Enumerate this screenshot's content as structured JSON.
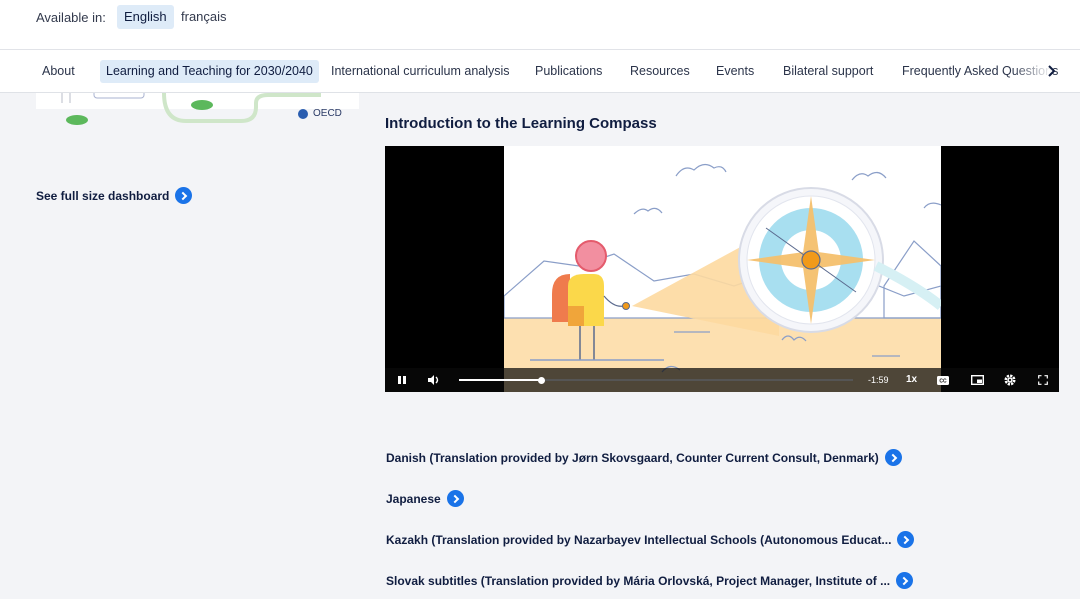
{
  "language_bar": {
    "label": "Available in:",
    "languages": [
      {
        "label": "English",
        "active": true
      },
      {
        "label": "français",
        "active": false
      }
    ]
  },
  "nav": {
    "items": [
      {
        "label": "About"
      },
      {
        "label": "Learning and Teaching for 2030/2040",
        "active": true
      },
      {
        "label": "International curriculum analysis"
      },
      {
        "label": "Publications"
      },
      {
        "label": "Resources"
      },
      {
        "label": "Events"
      },
      {
        "label": "Bilateral support"
      },
      {
        "label": "Frequently Asked Questions"
      }
    ],
    "scroll_icon": "chevron-right-icon"
  },
  "dashboard": {
    "logo_text": "OECD",
    "see_full_label": "See full size dashboard"
  },
  "video": {
    "title": "Introduction to the Learning Compass",
    "remaining_time": "-1:59",
    "speed": "1x",
    "progress_fraction": 0.21,
    "state": "playing"
  },
  "translations": [
    {
      "label": "Danish (Translation provided by Jørn Skovsgaard, Counter Current Consult, Denmark)"
    },
    {
      "label": "Japanese"
    },
    {
      "label": "Kazakh (Translation provided by Nazarbayev Intellectual Schools (Autonomous Educat..."
    },
    {
      "label": "Slovak subtitles (Translation provided by Mária Orlovská, Project Manager, Institute of ..."
    }
  ],
  "colors": {
    "accent": "#1a73e8",
    "active_bg": "#deebf8",
    "text_dark": "#101d40",
    "page_bg": "#f3f4f7"
  }
}
